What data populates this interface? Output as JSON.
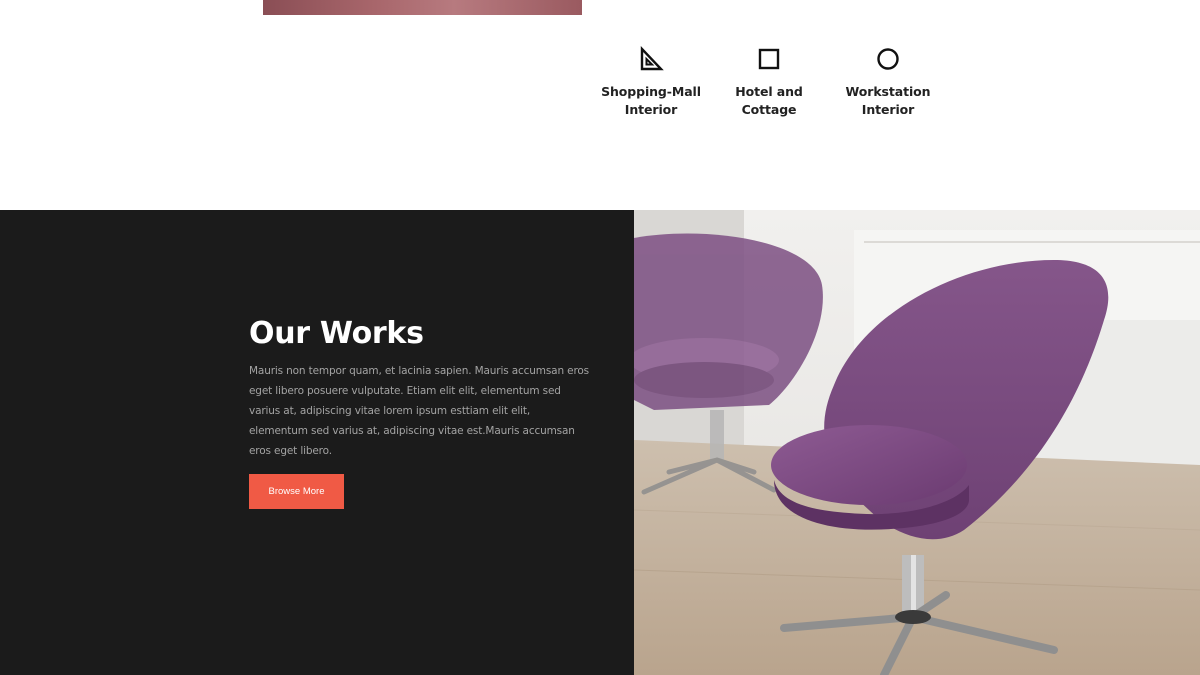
{
  "services": [
    {
      "label": "Shopping-Mall\nInterior",
      "icon": "triangle-ruler-icon"
    },
    {
      "label": "Hotel and\nCottage",
      "icon": "square-icon"
    },
    {
      "label": "Workstation\nInterior",
      "icon": "circle-icon"
    }
  ],
  "works": {
    "title": "Our Works",
    "text": "Mauris non tempor quam, et lacinia sapien. Mauris accumsan eros eget libero posuere vulputate. Etiam elit elit, elementum sed varius at, adipiscing vitae lorem ipsum esttiam elit elit, elementum sed varius at, adipiscing vitae est.Mauris accumsan eros eget libero.",
    "button_label": "Browse More",
    "button_color": "#f05a45",
    "background_color": "#1b1b1b"
  }
}
